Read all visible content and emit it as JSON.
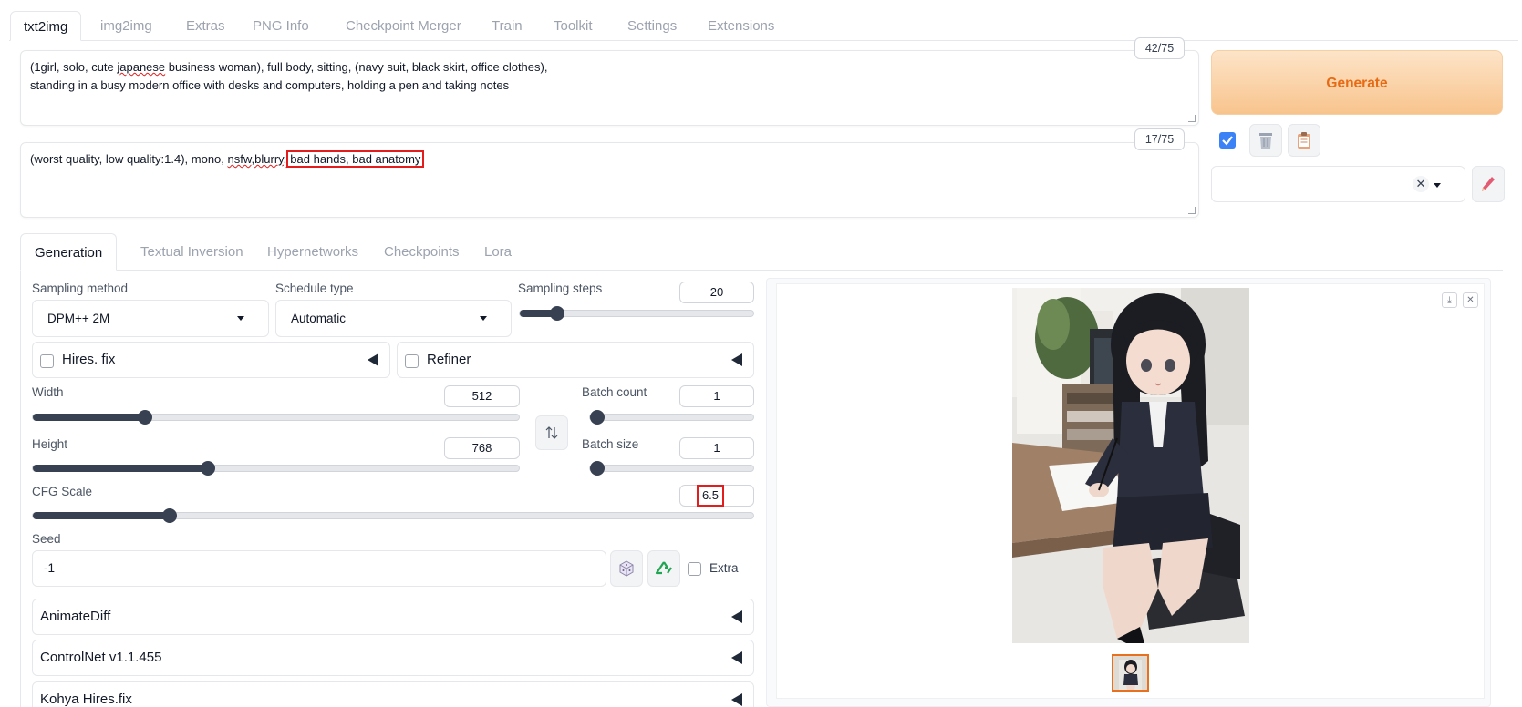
{
  "top_tabs": [
    "txt2img",
    "img2img",
    "Extras",
    "PNG Info",
    "Checkpoint Merger",
    "Train",
    "Toolkit",
    "Settings",
    "Extensions"
  ],
  "prompt": {
    "line1_a": "(1girl, solo, cute ",
    "line1_b": "japanese",
    "line1_c": " business woman), full body, sitting, (navy suit, black skirt, office clothes),",
    "line2": "standing in a busy modern office with desks and computers, holding a pen and taking notes",
    "counter": "42/75"
  },
  "negative_prompt": {
    "part_a": "(worst quality, low quality:1.4), mono, ",
    "part_b": "nsfw,blurry,",
    "part_c": "bad hands, bad anatomy",
    "counter": "17/75"
  },
  "generate_label": "Generate",
  "sub_tabs": [
    "Generation",
    "Textual Inversion",
    "Hypernetworks",
    "Checkpoints",
    "Lora"
  ],
  "sampling": {
    "method_label": "Sampling method",
    "method_value": "DPM++ 2M",
    "schedule_label": "Schedule type",
    "schedule_value": "Automatic",
    "steps_label": "Sampling steps",
    "steps_value": "20",
    "steps_fraction": 0.16
  },
  "hires_label": "Hires. fix",
  "refiner_label": "Refiner",
  "width": {
    "label": "Width",
    "value": "512",
    "fraction": 0.23
  },
  "height": {
    "label": "Height",
    "value": "768",
    "fraction": 0.36
  },
  "batch_count": {
    "label": "Batch count",
    "value": "1",
    "fraction": 0.0
  },
  "batch_size": {
    "label": "Batch size",
    "value": "1",
    "fraction": 0.0
  },
  "cfg": {
    "label": "CFG Scale",
    "value": "6.5",
    "fraction": 0.19
  },
  "seed": {
    "label": "Seed",
    "value": "-1",
    "extra_label": "Extra"
  },
  "accordions": [
    "AnimateDiff",
    "ControlNet v1.1.455",
    "Kohya Hires.fix"
  ],
  "colors": {
    "accent": "#e76a14",
    "highlight": "#e11d1d",
    "thumb_border": "#e8711f"
  }
}
